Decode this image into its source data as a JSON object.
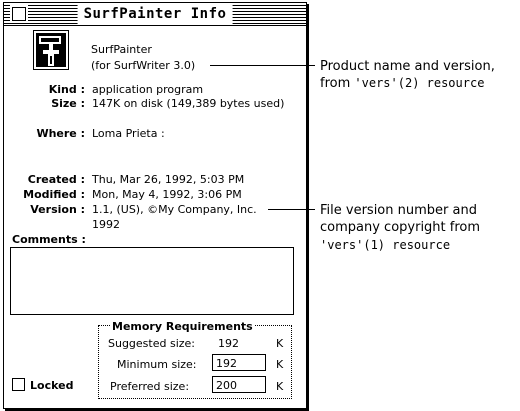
{
  "window": {
    "title": "SurfPainter Info"
  },
  "app": {
    "name": "SurfPainter",
    "for": "(for SurfWriter 3.0)",
    "icon": "paint-roller-icon"
  },
  "info": {
    "kind_label": "Kind :",
    "kind_value": "application program",
    "size_label": "Size :",
    "size_value": "147K on disk (149,389 bytes used)",
    "where_label": "Where :",
    "where_value": "Loma Prieta :",
    "created_label": "Created :",
    "created_value": "Thu, Mar 26, 1992, 5:03 PM",
    "modified_label": "Modified :",
    "modified_value": "Mon, May 4, 1992, 3:06 PM",
    "version_label": "Version :",
    "version_value": "1.1, (US), ©My Company, Inc.",
    "version_value_line2": "1992",
    "comments_label": "Comments :"
  },
  "memory": {
    "title": "Memory Requirements",
    "suggested_label": "Suggested size:",
    "suggested_value": "192",
    "minimum_label": "Minimum size:",
    "minimum_value": "192",
    "preferred_label": "Preferred size:",
    "preferred_value": "200",
    "unit": "K"
  },
  "locked_label": "Locked",
  "callouts": {
    "top_line1": "Product name and version,",
    "top_line2_prefix": "from ",
    "top_line2_code": "'vers'(2) resource",
    "bottom_line1": "File version number and",
    "bottom_line2": "company copyright from",
    "bottom_line3_code": "'vers'(1) resource"
  }
}
